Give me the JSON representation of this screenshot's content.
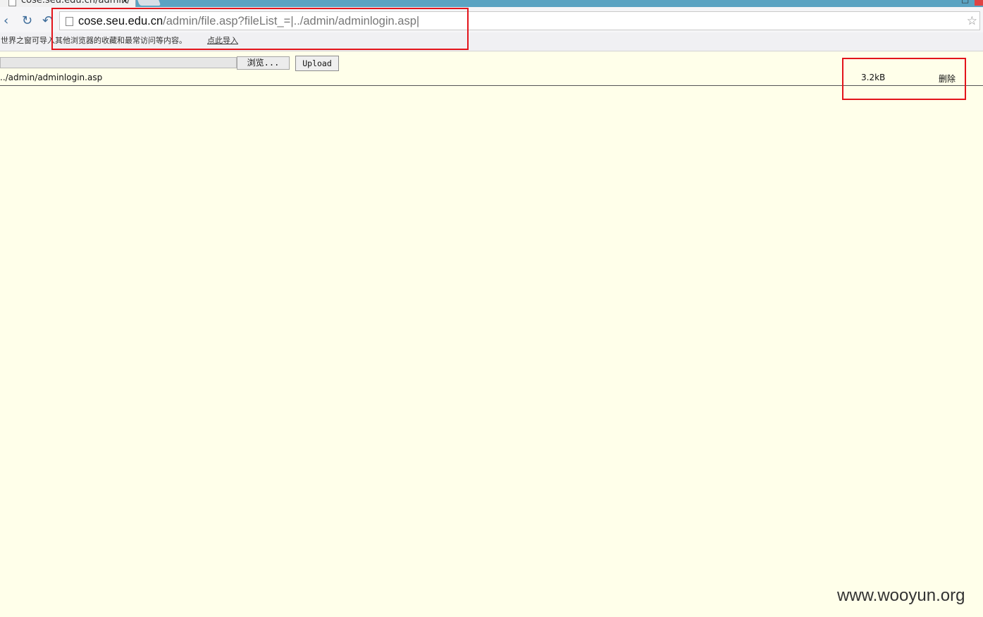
{
  "browser": {
    "tab_title": "cose.seu.edu.cn/admin/",
    "tab_close": "×",
    "window_min": "–",
    "window_max": "□",
    "nav": {
      "back_icon": "‹",
      "refresh_icon": "↻",
      "undo_icon": "↶"
    },
    "url_host": "cose.seu.edu.cn",
    "url_path": "/admin/file.asp?fileList_=|../admin/adminlogin.asp|",
    "star_icon": "☆"
  },
  "bookmarks_bar": {
    "message": "世界之窗可导入其他浏览器的收藏和最常访问等内容。",
    "import_link": "点此导入"
  },
  "page": {
    "browse_button": "浏览...",
    "upload_button": "Upload",
    "file": {
      "name": "../admin/adminlogin.asp",
      "size": "3.2kB",
      "delete_label": "删除"
    }
  },
  "watermark": "www.wooyun.org",
  "colors": {
    "page_bg": "#ffffea",
    "highlight_box": "#e3141b",
    "title_bar": "#5aa3c2"
  }
}
